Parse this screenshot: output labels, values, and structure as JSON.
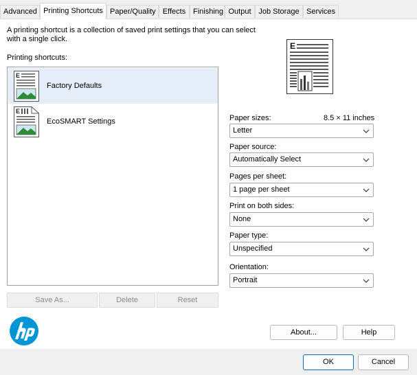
{
  "tabs": [
    {
      "label": "Advanced",
      "active": false
    },
    {
      "label": "Printing Shortcuts",
      "active": true
    },
    {
      "label": "Paper/Quality",
      "active": false
    },
    {
      "label": "Effects",
      "active": false
    },
    {
      "label": "Finishing",
      "active": false
    },
    {
      "label": "Output",
      "active": false
    },
    {
      "label": "Job Storage",
      "active": false
    },
    {
      "label": "Services",
      "active": false
    }
  ],
  "description": {
    "line1": "A printing shortcut is a collection of saved print settings that you can select",
    "line2": "with a single click."
  },
  "shortcuts_label": "Printing shortcuts:",
  "shortcuts": [
    {
      "label": "Factory Defaults",
      "selected": true,
      "icon": "document-image-icon"
    },
    {
      "label": "EcoSMART Settings",
      "selected": false,
      "icon": "eco-document-icon"
    }
  ],
  "list_buttons": {
    "save_as": "Save As...",
    "delete": "Delete",
    "reset": "Reset"
  },
  "settings": {
    "paper_sizes": {
      "label": "Paper sizes:",
      "dimension": "8.5 × 11 inches",
      "value": "Letter"
    },
    "paper_source": {
      "label": "Paper source:",
      "value": "Automatically Select"
    },
    "pages_per_sheet": {
      "label": "Pages per sheet:",
      "value": "1 page per sheet"
    },
    "print_both_sides": {
      "label": "Print on both sides:",
      "value": "None"
    },
    "paper_type": {
      "label": "Paper type:",
      "value": "Unspecified"
    },
    "orientation": {
      "label": "Orientation:",
      "value": "Portrait"
    }
  },
  "buttons": {
    "about": "About...",
    "help": "Help",
    "ok": "OK",
    "cancel": "Cancel"
  },
  "colors": {
    "hp_blue": "#0096d6",
    "selection": "#e5eef8",
    "disabled_text": "#8a8a8a"
  }
}
